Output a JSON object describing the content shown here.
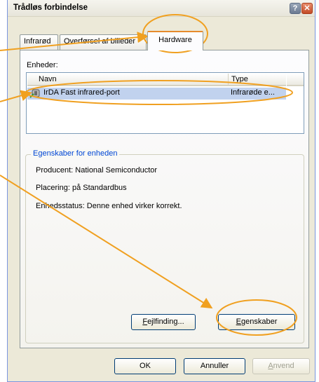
{
  "window": {
    "title": "Trådløs forbindelse",
    "help_glyph": "?",
    "close_glyph": "✕"
  },
  "tabs": [
    {
      "label": "Infrarød",
      "selected": false
    },
    {
      "label": "Overførsel af billeder",
      "selected": false
    },
    {
      "label": "Hardware",
      "selected": true
    }
  ],
  "devices": {
    "label": "Enheder:",
    "columns": [
      "Navn",
      "Type"
    ],
    "rows": [
      {
        "name": "IrDA Fast infrared-port",
        "type": "Infrarøde e..."
      }
    ]
  },
  "properties": {
    "legend": "Egenskaber for enheden",
    "manufacturer": "Producent: National Semiconductor",
    "location": "Placering: på Standardbus",
    "status": "Enhedsstatus: Denne enhed virker korrekt."
  },
  "buttons": {
    "troubleshoot": {
      "mnemonic": "F",
      "rest": "ejlfinding..."
    },
    "properties": {
      "mnemonic": "E",
      "rest": "genskaber"
    },
    "ok": "OK",
    "cancel": "Annuller",
    "apply": {
      "mnemonic": "A",
      "rest": "nvend"
    }
  },
  "annotation_color": "#f0a020"
}
